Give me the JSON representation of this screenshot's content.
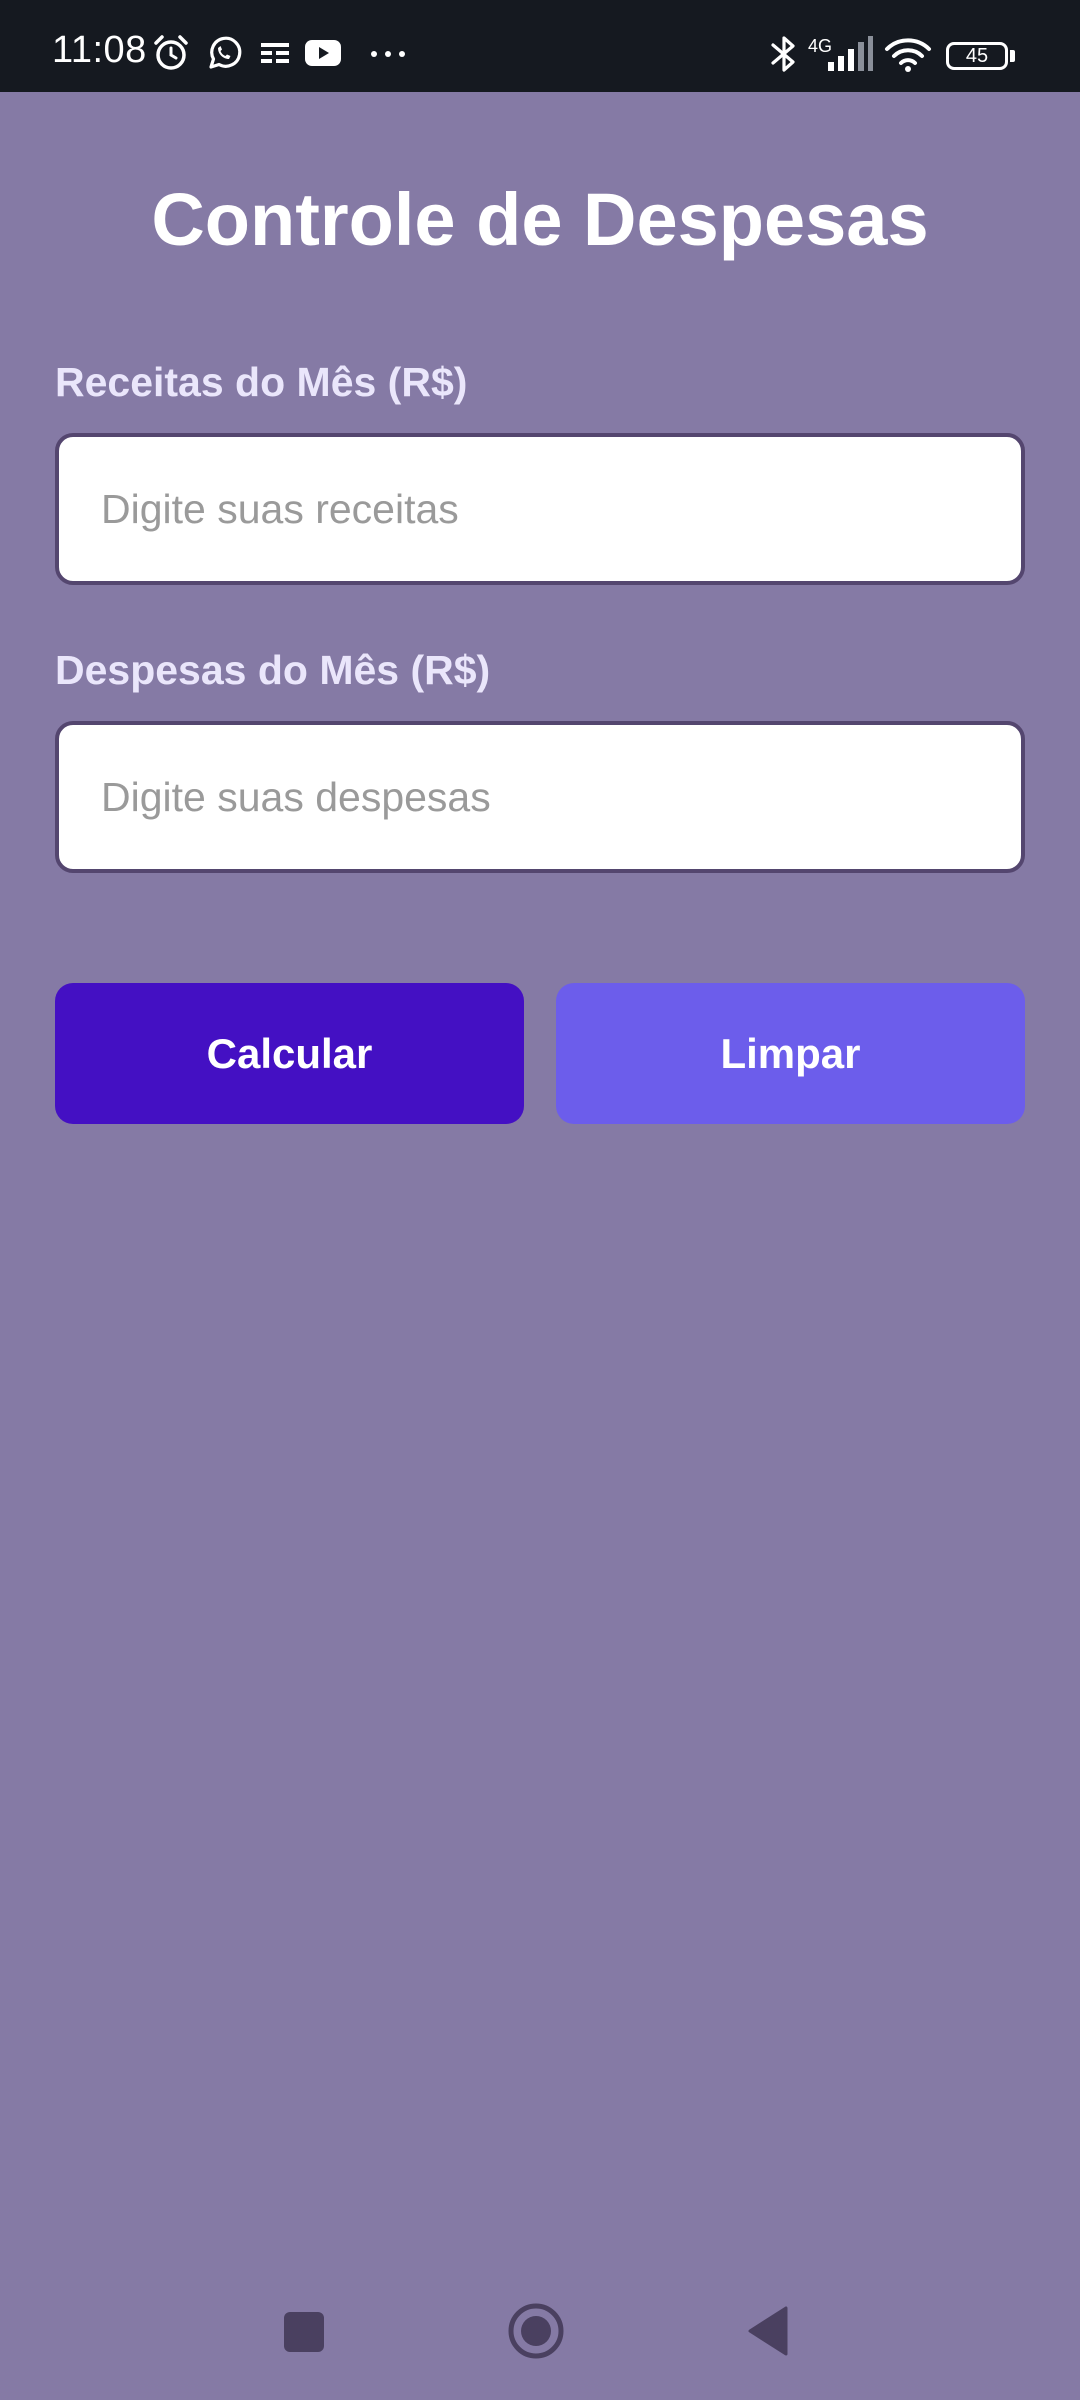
{
  "status_bar": {
    "time": "11:08",
    "network": "4G",
    "battery": "45",
    "icons": [
      "alarm-icon",
      "whatsapp-icon",
      "notes-icon",
      "youtube-icon",
      "more-icon",
      "bluetooth-icon",
      "signal-icon",
      "wifi-icon",
      "battery-icon"
    ]
  },
  "main": {
    "title": "Controle de Despesas",
    "income": {
      "label": "Receitas do Mês (R$)",
      "placeholder": "Digite suas receitas",
      "value": ""
    },
    "expenses": {
      "label": "Despesas do Mês (R$)",
      "placeholder": "Digite suas despesas",
      "value": ""
    },
    "buttons": {
      "calculate": "Calcular",
      "clear": "Limpar"
    }
  },
  "nav_bar": {
    "icons": [
      "recents-icon",
      "home-icon",
      "back-icon"
    ]
  },
  "colors": {
    "background": "#857aa5",
    "status_bar": "#151920",
    "calculate_button": "#4410c3",
    "clear_button": "#6c5deb",
    "input_border": "#54466f"
  }
}
